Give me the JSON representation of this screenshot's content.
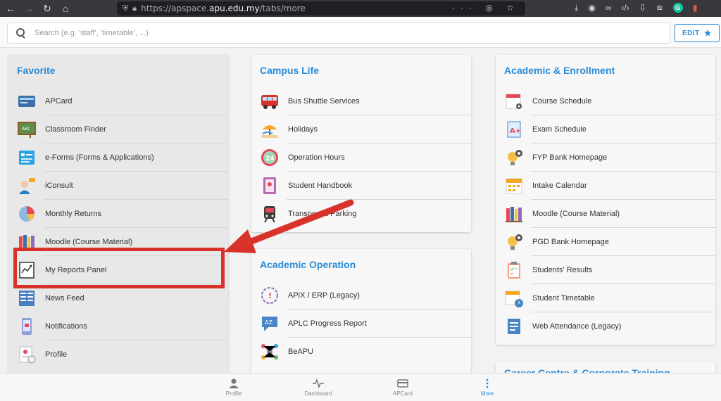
{
  "browser": {
    "url_prefix": "https://apspace.",
    "url_domain": "apu.edu.my",
    "url_path": "/tabs/more",
    "page_actions": "··· ◎ ☆"
  },
  "search": {
    "placeholder": "Search (e.g. 'staff', 'timetable', ...)"
  },
  "edit_button": {
    "label": "EDIT",
    "icon": "star-icon"
  },
  "columns": {
    "favorite": {
      "title": "Favorite",
      "items": [
        {
          "label": "APCard",
          "icon": "card-icon"
        },
        {
          "label": "Classroom Finder",
          "icon": "chalkboard-icon"
        },
        {
          "label": "e-Forms (Forms & Applications)",
          "icon": "form-icon"
        },
        {
          "label": "iConsult",
          "icon": "consult-icon"
        },
        {
          "label": "Monthly Returns",
          "icon": "pie-chart-icon"
        },
        {
          "label": "Moodle (Course Material)",
          "icon": "books-icon"
        },
        {
          "label": "My Reports Panel",
          "icon": "report-icon"
        },
        {
          "label": "News Feed",
          "icon": "news-icon"
        },
        {
          "label": "Notifications",
          "icon": "phone-notification-icon"
        },
        {
          "label": "Profile",
          "icon": "profile-doc-icon"
        }
      ]
    },
    "campus_life": {
      "title": "Campus Life",
      "items": [
        {
          "label": "Bus Shuttle Services",
          "icon": "bus-icon"
        },
        {
          "label": "Holidays",
          "icon": "beach-icon"
        },
        {
          "label": "Operation Hours",
          "icon": "clock-24-icon"
        },
        {
          "label": "Student Handbook",
          "icon": "handbook-icon"
        },
        {
          "label": "Transport & Parking",
          "icon": "train-icon"
        }
      ]
    },
    "academic_operation": {
      "title": "Academic Operation",
      "items": [
        {
          "label": "APiX / ERP (Legacy)",
          "icon": "apix-icon"
        },
        {
          "label": "APLC Progress Report",
          "icon": "language-icon"
        },
        {
          "label": "BeAPU",
          "icon": "network-icon"
        }
      ]
    },
    "academic_enrollment": {
      "title": "Academic & Enrollment",
      "items": [
        {
          "label": "Course Schedule",
          "icon": "calendar-eye-icon"
        },
        {
          "label": "Exam Schedule",
          "icon": "grade-doc-icon"
        },
        {
          "label": "FYP Bank Homepage",
          "icon": "bulb-gear-icon"
        },
        {
          "label": "Intake Calendar",
          "icon": "calendar-icon"
        },
        {
          "label": "Moodle (Course Material)",
          "icon": "books-icon"
        },
        {
          "label": "PGD Bank Homepage",
          "icon": "bulb-gear-icon"
        },
        {
          "label": "Students' Results",
          "icon": "clipboard-icon"
        },
        {
          "label": "Student Timetable",
          "icon": "calendar-clock-icon"
        },
        {
          "label": "Web Attendance (Legacy)",
          "icon": "doc-list-icon"
        }
      ]
    },
    "next_section_partial": "Career Centre & Corporate Training"
  },
  "tabbar": [
    {
      "label": "Profile",
      "icon": "person-icon",
      "active": false
    },
    {
      "label": "Dashboard",
      "icon": "pulse-icon",
      "active": false
    },
    {
      "label": "APCard",
      "icon": "card-icon",
      "active": false
    },
    {
      "label": "More",
      "icon": "more-vertical-icon",
      "active": true
    }
  ],
  "colors": {
    "accent": "#2b8bd6",
    "annotation_red": "#d9322a"
  }
}
